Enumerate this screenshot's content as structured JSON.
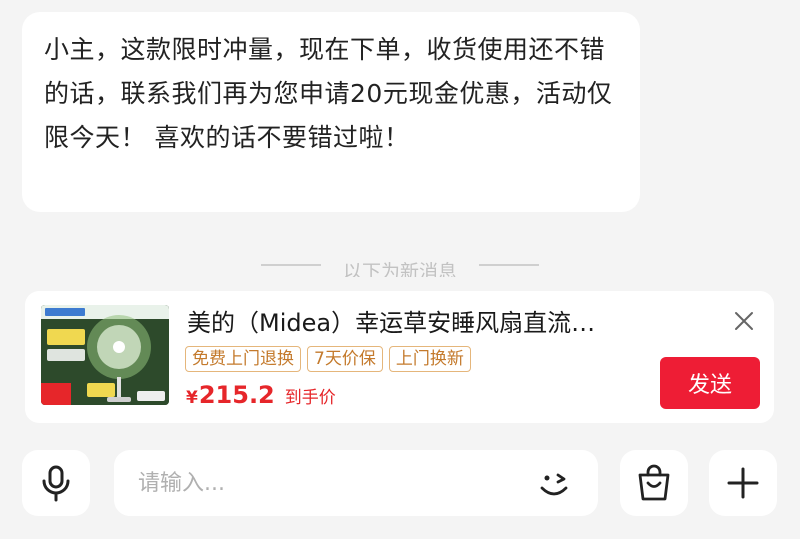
{
  "message": {
    "text": "小主，这款限时冲量，现在下单，收货使用还不错的话，联系我们再为您申请20元现金优惠，活动仅限今天！ 喜欢的话不要错过啦！"
  },
  "divider": {
    "label": "以下为新消息"
  },
  "product_card": {
    "title": "美的（Midea）幸运草安睡风扇直流…",
    "tags": [
      "免费上门退换",
      "7天价保",
      "上门换新"
    ],
    "currency": "¥",
    "price": "215.2",
    "price_label": "到手价",
    "send_label": "发送",
    "image_icon": "electric-fan-product-photo"
  },
  "input_bar": {
    "placeholder": "请输入...",
    "icons": [
      "microphone-icon",
      "emoji-icon",
      "shopping-bag-icon",
      "plus-icon",
      "close-icon"
    ]
  },
  "colors": {
    "accent_red": "#ee1d35",
    "price_red": "#e6262a",
    "tag_orange": "#c47a2c",
    "background": "#f4f4f4"
  }
}
